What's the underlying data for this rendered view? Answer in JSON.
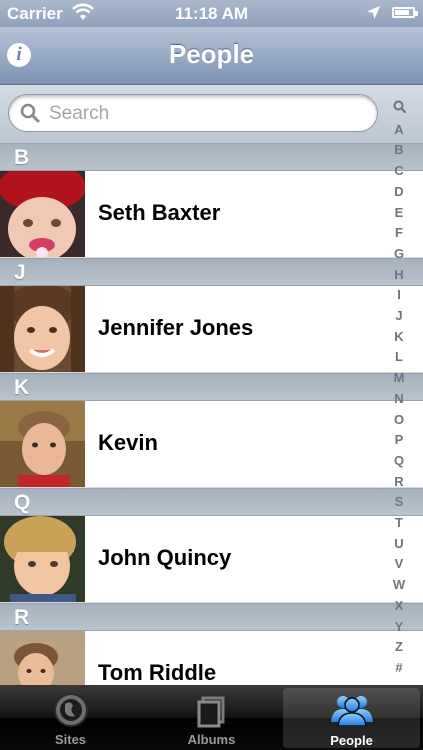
{
  "status_bar": {
    "carrier": "Carrier",
    "time": "11:18 AM",
    "battery_level": 0.85
  },
  "nav": {
    "title": "People",
    "info_icon": "info-icon"
  },
  "search": {
    "placeholder": "Search"
  },
  "sections": [
    {
      "letter": "B",
      "people": [
        {
          "name": "Seth Baxter"
        }
      ]
    },
    {
      "letter": "J",
      "people": [
        {
          "name": "Jennifer Jones"
        }
      ]
    },
    {
      "letter": "K",
      "people": [
        {
          "name": "Kevin"
        }
      ]
    },
    {
      "letter": "Q",
      "people": [
        {
          "name": "John Quincy"
        }
      ]
    },
    {
      "letter": "R",
      "people": [
        {
          "name": "Tom Riddle"
        }
      ]
    }
  ],
  "index_letters": [
    "A",
    "B",
    "C",
    "D",
    "E",
    "F",
    "G",
    "H",
    "I",
    "J",
    "K",
    "L",
    "M",
    "N",
    "O",
    "P",
    "Q",
    "R",
    "S",
    "T",
    "U",
    "V",
    "W",
    "X",
    "Y",
    "Z",
    "#"
  ],
  "tabs": [
    {
      "label": "Sites",
      "icon": "globe-icon"
    },
    {
      "label": "Albums",
      "icon": "albums-icon"
    },
    {
      "label": "People",
      "icon": "people-icon",
      "selected": true
    }
  ],
  "colors": {
    "nav_bar": "#8fa2bb",
    "section_header": "#aeb9c4",
    "tab_bar": "#141414"
  }
}
